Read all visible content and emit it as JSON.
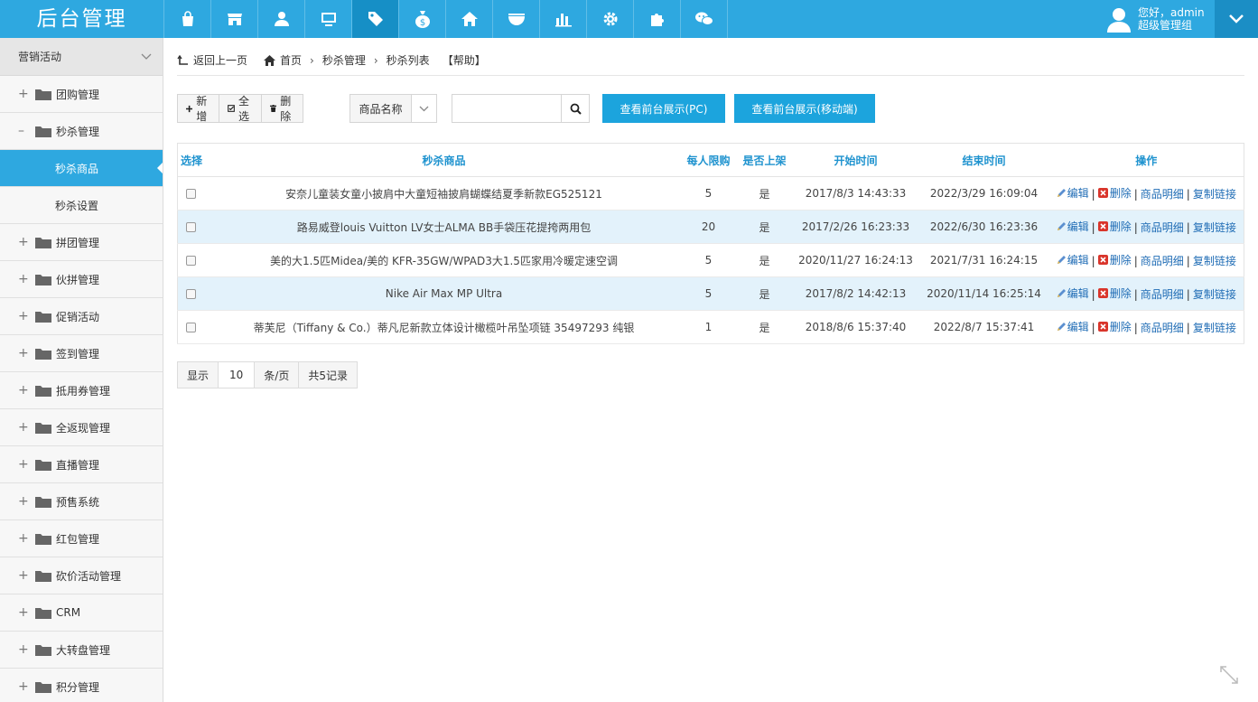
{
  "app": {
    "title": "后台管理"
  },
  "nav": {
    "icons": [
      "shopping-bag-icon",
      "store-icon",
      "user-icon",
      "monitor-icon",
      "tag-icon",
      "money-bag-icon",
      "home-icon",
      "bowl-icon",
      "bar-chart-icon",
      "gear-icon",
      "puzzle-icon",
      "wechat-icon"
    ],
    "active_index": 4
  },
  "user": {
    "greeting": "您好，admin",
    "role": "超级管理组"
  },
  "sidebar": {
    "section": "营销活动",
    "items": [
      {
        "label": "团购管理",
        "expanded": false
      },
      {
        "label": "秒杀管理",
        "expanded": true,
        "children": [
          {
            "label": "秒杀商品",
            "active": true
          },
          {
            "label": "秒杀设置",
            "active": false
          }
        ]
      },
      {
        "label": "拼团管理",
        "expanded": false
      },
      {
        "label": "伙拼管理",
        "expanded": false
      },
      {
        "label": "促销活动",
        "expanded": false
      },
      {
        "label": "签到管理",
        "expanded": false
      },
      {
        "label": "抵用券管理",
        "expanded": false
      },
      {
        "label": "全返现管理",
        "expanded": false
      },
      {
        "label": "直播管理",
        "expanded": false
      },
      {
        "label": "预售系统",
        "expanded": false
      },
      {
        "label": "红包管理",
        "expanded": false
      },
      {
        "label": "砍价活动管理",
        "expanded": false
      },
      {
        "label": "CRM",
        "expanded": false
      },
      {
        "label": "大转盘管理",
        "expanded": false
      },
      {
        "label": "积分管理",
        "expanded": false
      }
    ]
  },
  "breadcrumb": {
    "back": "返回上一页",
    "home": "首页",
    "level1": "秒杀管理",
    "level2": "秒杀列表",
    "help": "【帮助】"
  },
  "toolbar": {
    "add": "新增",
    "select_all": "全选",
    "delete": "删除",
    "field_select": "商品名称",
    "search_value": "",
    "pc_button": "查看前台展示(PC)",
    "mobile_button": "查看前台展示(移动端)"
  },
  "table": {
    "headers": {
      "select": "选择",
      "product": "秒杀商品",
      "limit": "每人限购",
      "on_sale": "是否上架",
      "start": "开始时间",
      "end": "结束时间",
      "ops": "操作"
    },
    "ops_labels": {
      "edit": "编辑",
      "delete": "删除",
      "detail": "商品明细",
      "copy": "复制链接"
    },
    "rows": [
      {
        "product": "安奈儿童装女童小披肩中大童短袖披肩蝴蝶结夏季新款EG525121",
        "limit": "5",
        "on_sale": "是",
        "start": "2017/8/3 14:43:33",
        "end": "2022/3/29 16:09:04"
      },
      {
        "product": "路易威登louis Vuitton LV女士ALMA BB手袋压花提挎两用包",
        "limit": "20",
        "on_sale": "是",
        "start": "2017/2/26 16:23:33",
        "end": "2022/6/30 16:23:36"
      },
      {
        "product": "美的大1.5匹Midea/美的 KFR-35GW/WPAD3大1.5匹家用冷暖定速空调",
        "limit": "5",
        "on_sale": "是",
        "start": "2020/11/27 16:24:13",
        "end": "2021/7/31 16:24:15"
      },
      {
        "product": "Nike Air Max MP Ultra",
        "limit": "5",
        "on_sale": "是",
        "start": "2017/8/2 14:42:13",
        "end": "2020/11/14 16:25:14"
      },
      {
        "product": "蒂芙尼（Tiffany & Co.）蒂凡尼新款立体设计橄榄叶吊坠项链 35497293 纯银",
        "limit": "1",
        "on_sale": "是",
        "start": "2018/8/6 15:37:40",
        "end": "2022/8/7 15:37:41"
      }
    ]
  },
  "pager": {
    "show": "显示",
    "page_size": "10",
    "per_page": "条/页",
    "total": "共5记录"
  },
  "colors": {
    "primary": "#2ea8e0",
    "header_text": "#1f93cf",
    "alt_row": "#e3f2fb",
    "link": "#1f6cb5"
  }
}
